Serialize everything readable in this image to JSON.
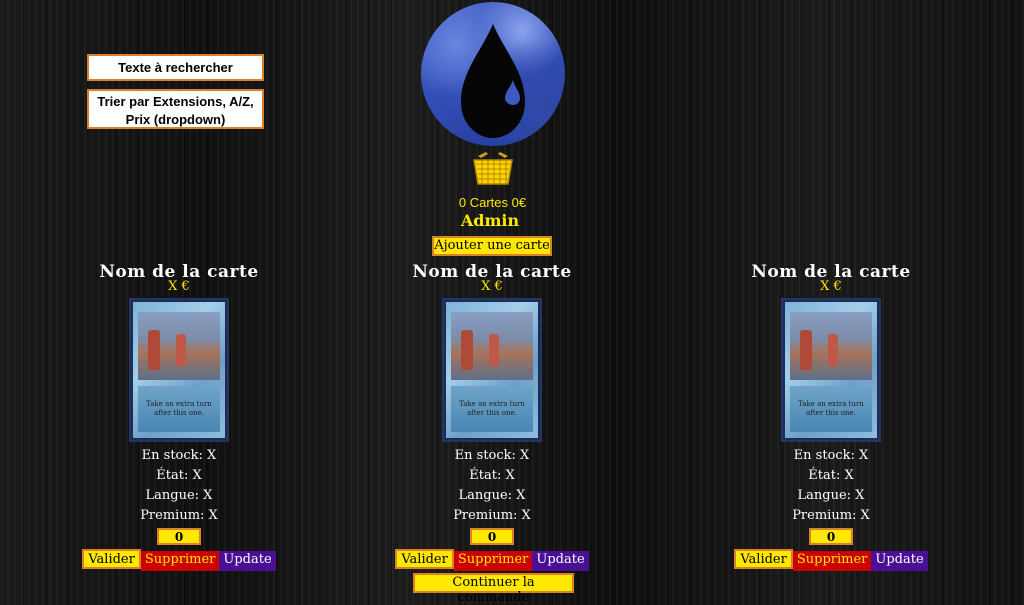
{
  "search": {
    "label": "Texte à rechercher"
  },
  "sort": {
    "label": "Trier par Extensions, A/Z, Prix (dropdown)"
  },
  "header": {
    "cart_summary": "0 Cartes 0€",
    "user": "Admin",
    "add_card_label": "Ajouter une carte",
    "continue_label": "Continuer la commande"
  },
  "colors": {
    "accent": "#ffe800",
    "border": "#d9822b",
    "danger": "#cc0000",
    "update": "#4a0f94"
  },
  "cards": [
    {
      "name": "Nom de la carte",
      "price": "X €",
      "card_text": "Take an extra turn after this one.",
      "stock": "En stock: X",
      "state": "État: X",
      "lang": "Langue: X",
      "premium": "Premium: X",
      "qty": "0",
      "valider": "Valider",
      "supprimer": "Supprimer",
      "update": "Update"
    },
    {
      "name": "Nom de la carte",
      "price": "X €",
      "card_text": "Take an extra turn after this one.",
      "stock": "En stock: X",
      "state": "État: X",
      "lang": "Langue: X",
      "premium": "Premium: X",
      "qty": "0",
      "valider": "Valider",
      "supprimer": "Supprimer",
      "update": "Update"
    },
    {
      "name": "Nom de la carte",
      "price": "X €",
      "card_text": "Take an extra turn after this one.",
      "stock": "En stock: X",
      "state": "État: X",
      "lang": "Langue: X",
      "premium": "Premium: X",
      "qty": "0",
      "valider": "Valider",
      "supprimer": "Supprimer",
      "update": "Update"
    }
  ]
}
